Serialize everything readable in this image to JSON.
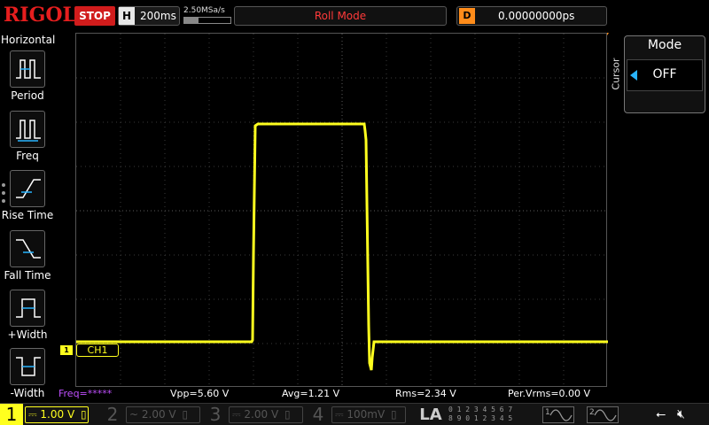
{
  "header": {
    "logo": "RIGOL",
    "run_state": "STOP",
    "timebase_key": "H",
    "timebase": "200ms",
    "sample_rate": "2.50MSa/s",
    "mode_status": "Roll Mode",
    "delay_key": "D",
    "delay": "0.00000000ps"
  },
  "left_menu": {
    "title": "Horizontal",
    "items": [
      {
        "label": "Period",
        "icon": "period-icon"
      },
      {
        "label": "Freq",
        "icon": "frequency-icon"
      },
      {
        "label": "Rise Time",
        "icon": "rise-time-icon"
      },
      {
        "label": "Fall Time",
        "icon": "fall-time-icon"
      },
      {
        "label": "+Width",
        "icon": "positive-width-icon"
      },
      {
        "label": "-Width",
        "icon": "negative-width-icon"
      }
    ]
  },
  "right_panel": {
    "tab_label": "Cursor",
    "card_title": "Mode",
    "card_value": "OFF"
  },
  "channel_marker": {
    "number": "1",
    "label": "CH1"
  },
  "measurements": {
    "freq": "Freq=*****",
    "vpp": "Vpp=5.60 V",
    "avg": "Avg=1.21 V",
    "rms": "Rms=2.34 V",
    "per_vrms": "Per.Vrms=0.00 V"
  },
  "bottom_bar": {
    "channels": [
      {
        "num": "1",
        "scale": "1.00 V",
        "active": true
      },
      {
        "num": "2",
        "scale": "2.00 V",
        "active": false
      },
      {
        "num": "3",
        "scale": "2.00 V",
        "active": false
      },
      {
        "num": "4",
        "scale": "100mV",
        "active": false
      }
    ],
    "la_label": "LA",
    "la_digits_top": "0 1 2 3  4 5 6 7",
    "la_digits_bottom": "8 9 0 1  2 3 4 5",
    "gen1": "1",
    "gen2": "2"
  },
  "colors": {
    "ch1": "#ffff1e",
    "logo": "#e61e1e",
    "stop": "#d11c1c",
    "mode_status": "#ff3a3a",
    "delay_key": "#ff8c1a",
    "freq_meas": "#c050ff",
    "cursor_arrow": "#28b4ff"
  }
}
